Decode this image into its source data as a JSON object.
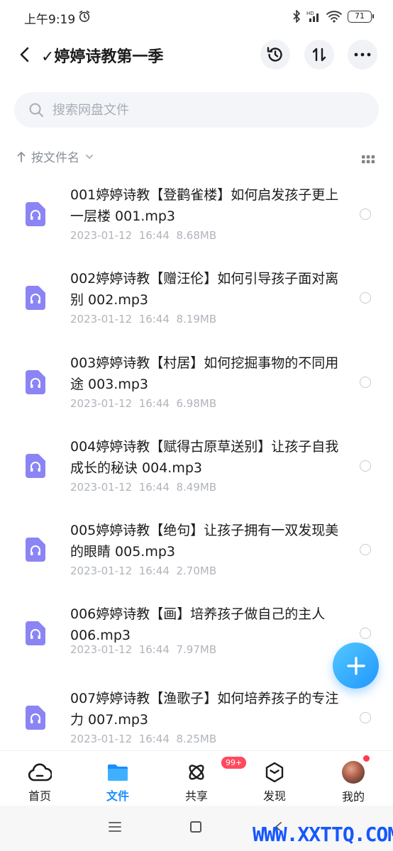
{
  "status_bar": {
    "time": "上午9:19",
    "battery": "71"
  },
  "header": {
    "title": "✓婷婷诗教第一季"
  },
  "search": {
    "placeholder": "搜索网盘文件"
  },
  "sort": {
    "label": "按文件名"
  },
  "files": [
    {
      "name": "001婷婷诗教【登鹳雀楼】如何启发孩子更上一层楼 001.mp3",
      "date": "2023-01-12  16:44",
      "size": "8.68MB"
    },
    {
      "name": "002婷婷诗教【赠汪伦】如何引导孩子面对离别 002.mp3",
      "date": "2023-01-12  16:44",
      "size": "8.19MB"
    },
    {
      "name": "003婷婷诗教【村居】如何挖掘事物的不同用途 003.mp3",
      "date": "2023-01-12  16:44",
      "size": "6.98MB"
    },
    {
      "name": "004婷婷诗教【赋得古原草送别】让孩子自我成长的秘诀 004.mp3",
      "date": "2023-01-12  16:44",
      "size": "8.49MB"
    },
    {
      "name": "005婷婷诗教【绝句】让孩子拥有一双发现美的眼睛 005.mp3",
      "date": "2023-01-12  16:44",
      "size": "2.70MB"
    },
    {
      "name": "006婷婷诗教【画】培养孩子做自己的主人 006.mp3",
      "date": "2023-01-12  16:44",
      "size": "7.97MB"
    },
    {
      "name": "007婷婷诗教【渔歌子】如何培养孩子的专注力 007.mp3",
      "date": "2023-01-12  16:44",
      "size": "8.25MB"
    }
  ],
  "bottom_nav": {
    "home": "首页",
    "files": "文件",
    "share": "共享",
    "share_badge": "99+",
    "discover": "发现",
    "me": "我的"
  },
  "watermark": "WWW.XXTTQ.COM",
  "colors": {
    "accent": "#1a8dff",
    "audio_icon": "#8b84f5",
    "badge": "#ff4a5e"
  }
}
